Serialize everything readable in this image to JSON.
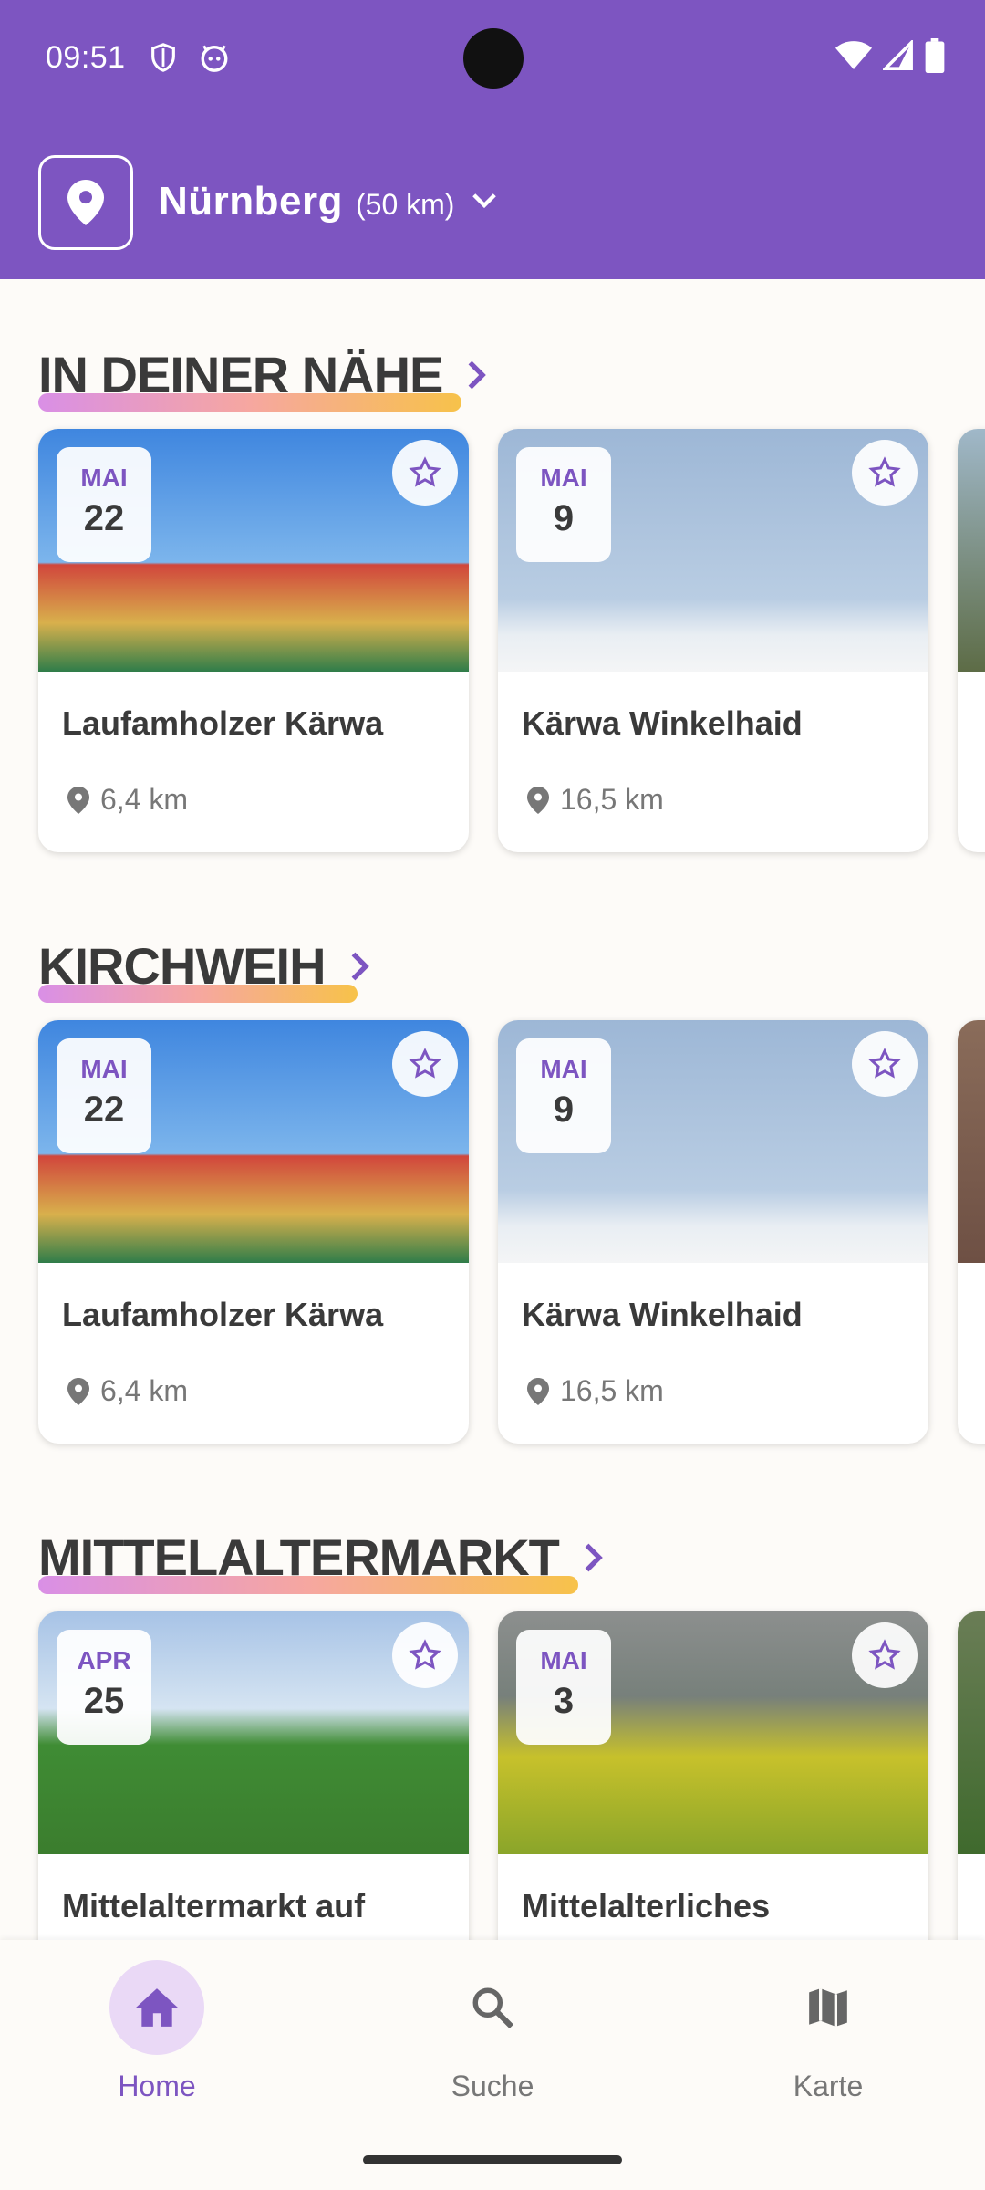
{
  "status": {
    "time": "09:51"
  },
  "header": {
    "city": "Nürnberg",
    "radius": "(50 km)"
  },
  "sections": [
    {
      "title": "IN DEINER NÄHE",
      "cards": [
        {
          "month": "MAI",
          "day": "22",
          "title": "Laufamholzer Kärwa",
          "distance": "6,4 km",
          "image": "carousel"
        },
        {
          "month": "MAI",
          "day": "9",
          "title": "Kärwa Winkelhaid",
          "distance": "16,5 km",
          "image": "maypole"
        }
      ]
    },
    {
      "title": "KIRCHWEIH",
      "cards": [
        {
          "month": "MAI",
          "day": "22",
          "title": "Laufamholzer Kärwa",
          "distance": "6,4 km",
          "image": "carousel"
        },
        {
          "month": "MAI",
          "day": "9",
          "title": "Kärwa Winkelhaid",
          "distance": "16,5 km",
          "image": "maypole"
        }
      ]
    },
    {
      "title": "MITTELALTERMARKT",
      "cards": [
        {
          "month": "APR",
          "day": "25",
          "title": "Mittelaltermarkt auf",
          "image": "medieval"
        },
        {
          "month": "MAI",
          "day": "3",
          "title": "Mittelalterliches",
          "image": "meadow"
        }
      ]
    }
  ],
  "nav": {
    "home": "Home",
    "search": "Suche",
    "map": "Karte"
  },
  "colors": {
    "primary": "#7d55c1",
    "nav_active_bg": "#ead9f6"
  }
}
